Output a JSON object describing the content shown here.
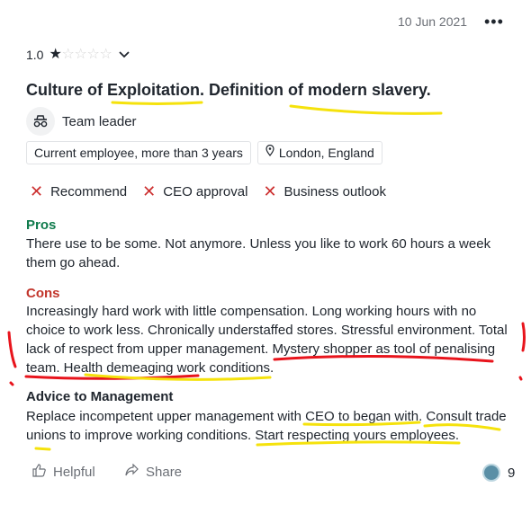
{
  "header": {
    "date": "10 Jun 2021",
    "more_icon": "more-horizontal-icon"
  },
  "rating": {
    "value": "1.0",
    "stars_filled": 1,
    "stars_total": 5
  },
  "review": {
    "title": "Culture of Exploitation. Definition of modern slavery.",
    "role": "Team leader",
    "employment": "Current employee, more than 3 years",
    "location": "London, England"
  },
  "approvals": [
    {
      "label": "Recommend"
    },
    {
      "label": "CEO approval"
    },
    {
      "label": "Business outlook"
    }
  ],
  "pros": {
    "label": "Pros",
    "text": "There use to be some. Not anymore. Unless you like to work 60 hours a week them go ahead."
  },
  "cons": {
    "label": "Cons",
    "text": "Increasingly hard work with little compensation. Long working hours with no choice to work less. Chronically understaffed stores. Stressful environment. Total lack of respect from upper management. Mystery shopper as tool of penalising team. Health demeaging work conditions."
  },
  "advice": {
    "label": "Advice to Management",
    "text": "Replace incompetent upper management with CEO to began with. Consult trade unions to improve working conditions. Start respecting yours employees."
  },
  "footer": {
    "helpful": "Helpful",
    "share": "Share",
    "count": "9"
  },
  "colors": {
    "highlight_yellow": "#f5e20c",
    "highlight_red": "#e8141c",
    "pros": "#0f7b4c",
    "cons": "#c2352b"
  }
}
